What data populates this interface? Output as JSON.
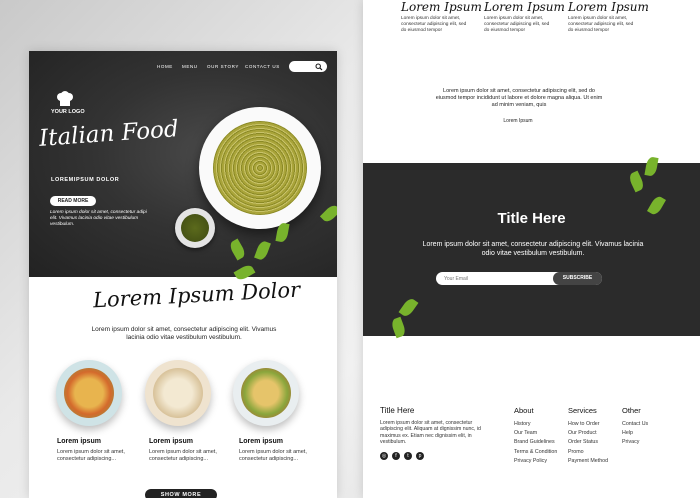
{
  "left": {
    "nav": [
      "HOME",
      "MENU",
      "OUR STORY",
      "CONTACT US"
    ],
    "logo": "YOUR LOGO",
    "hero_title": "Italian Food",
    "hero_subtitle": "LOREMIPSUM DOLOR",
    "read_more": "READ MORE",
    "hero_text": "Lorem ipsum dolor sit amet, consectetur adipi elit. Vivamus lacinia odio vitae vestibulum vestibulum.",
    "section_title": "Lorem Ipsum Dolor",
    "section_text": "Lorem ipsum dolor sit amet, consectetur adipiscing elit. Vivamus lacinia odio vitae vestibulum vestibulum.",
    "dishes": [
      {
        "title": "Lorem ipsum",
        "text": "Lorem ipsum dolor sit amet, consectetur adipiscing..."
      },
      {
        "title": "Lorem ipsum",
        "text": "Lorem ipsum dolor sit amet, consectetur adipiscing..."
      },
      {
        "title": "Lorem ipsum",
        "text": "Lorem ipsum dolor sit amet, consectetur adipiscing..."
      }
    ],
    "show_more": "SHOW MORE"
  },
  "right": {
    "top_columns": [
      {
        "title": "Lorem Ipsum",
        "text": "Lorem ipsum dolor sit amet, consectetur adipiscing elit, sed do eiusmod tempor"
      },
      {
        "title": "Lorem Ipsum",
        "text": "Lorem ipsum dolor sit amet, consectetur adipiscing elit, sed do eiusmod tempor"
      },
      {
        "title": "Lorem Ipsum",
        "text": "Lorem ipsum dolor sit amet, consectetur adipiscing elit, sed do eiusmod tempor"
      }
    ],
    "mid_text": "Lorem ipsum dolor sit amet, consectetur adipiscing elit, sed do eiusmod tempor incididunt ut labore et dolore magna aliqua. Ut enim ad minim veniam, quis",
    "mid_label": "Lorem Ipsum",
    "band_title": "Title Here",
    "band_text": "Lorem ipsum dolor sit amet, consectetur adipiscing elit. Vivamus lacinia odio vitae vestibulum vestibulum.",
    "email_placeholder": "Your Email",
    "subscribe": "SUBSCRIBE",
    "footer": {
      "title": "Title Here",
      "text": "Lorem ipsum dolor sit amet, consectetur adipiscing elit. Aliquam at dignissim nunc, id maximus ex. Etiam nec dignissim elit, in vestibulum.",
      "columns": [
        {
          "title": "About",
          "items": [
            "History",
            "Our Team",
            "Brand Guidelines",
            "Terms & Condition",
            "Privacy Policy"
          ]
        },
        {
          "title": "Services",
          "items": [
            "How to Order",
            "Our Product",
            "Order Status",
            "Promo",
            "Payment Method"
          ]
        },
        {
          "title": "Other",
          "items": [
            "Contact Us",
            "Help",
            "Privacy"
          ]
        }
      ]
    }
  },
  "icons": {
    "search": "search-icon",
    "chef_hat": "chef-hat-icon",
    "social": [
      "instagram-icon",
      "facebook-icon",
      "twitter-icon",
      "pinterest-icon"
    ]
  },
  "colors": {
    "dark": "#2b2b2b",
    "leaf": "#78b32c",
    "pasta": "#a9a43a"
  }
}
